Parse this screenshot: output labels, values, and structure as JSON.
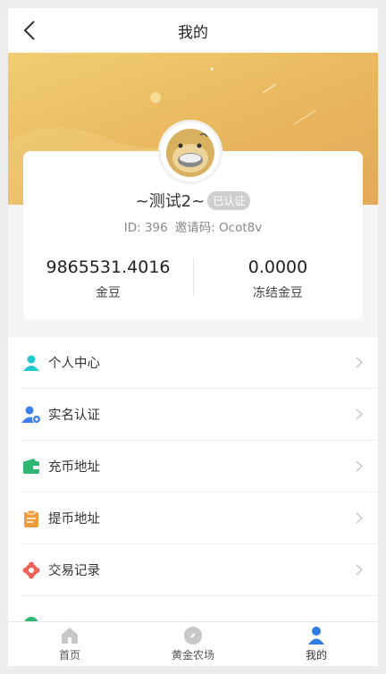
{
  "header": {
    "title": "我的",
    "back_icon": "back-arrow-icon"
  },
  "profile": {
    "nickname": "~测试2~",
    "badge": "已认证",
    "id_text": "ID: 396",
    "invite_text": "邀请码: Ocot8v"
  },
  "stats": [
    {
      "value": "9865531.4016",
      "label": "金豆"
    },
    {
      "value": "0.0000",
      "label": "冻结金豆"
    }
  ],
  "menu": [
    {
      "label": "个人中心",
      "icon": "user-icon",
      "color": "#22c7cf"
    },
    {
      "label": "实名认证",
      "icon": "user-verify-icon",
      "color": "#3b7ff0"
    },
    {
      "label": "充币地址",
      "icon": "wallet-icon",
      "color": "#2fb774"
    },
    {
      "label": "提币地址",
      "icon": "clipboard-icon",
      "color": "#f09a3c"
    },
    {
      "label": "交易记录",
      "icon": "flower-icon",
      "color": "#f0625a"
    }
  ],
  "tabs": [
    {
      "label": "首页",
      "icon": "home-icon"
    },
    {
      "label": "黄金农场",
      "icon": "compass-icon"
    },
    {
      "label": "我的",
      "icon": "person-icon"
    }
  ],
  "colors": {
    "accent": "#2e7de0",
    "banner": "#e9b75e"
  }
}
